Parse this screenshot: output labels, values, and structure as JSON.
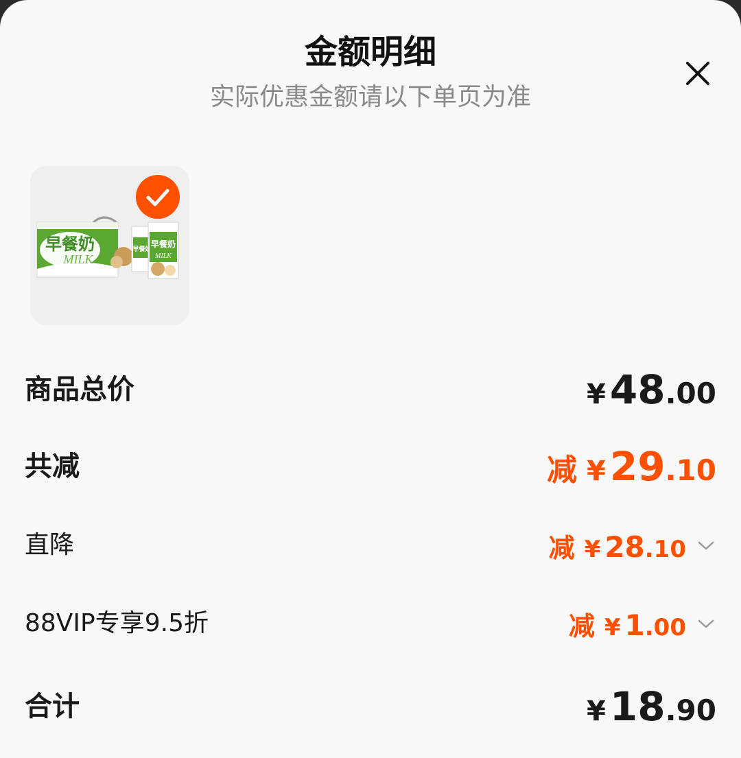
{
  "header": {
    "title": "金额明细",
    "subtitle": "实际优惠金额请以下单页为准"
  },
  "close_icon": "close-icon",
  "product": {
    "image": "早餐奶 MILK product box",
    "image_text": "早餐奶",
    "image_text_en": "MILK",
    "selected": true
  },
  "rows": {
    "total_price": {
      "label": "商品总价",
      "currency": "¥",
      "integer": "48",
      "decimal": ".00"
    },
    "discount_total": {
      "label": "共减",
      "prefix": "减",
      "currency": "¥",
      "integer": "29",
      "decimal": ".10"
    },
    "direct_discount": {
      "label": "直降",
      "prefix": "减",
      "currency": "¥",
      "integer": "28",
      "decimal": ".10"
    },
    "vip_discount": {
      "label": "88VIP专享9.5折",
      "prefix": "减",
      "currency": "¥",
      "integer": "1",
      "decimal": ".00"
    },
    "sum": {
      "label": "合计",
      "currency": "¥",
      "integer": "18",
      "decimal": ".90"
    }
  },
  "colors": {
    "accent": "#ff5000",
    "text": "#1a1a1a",
    "subtext": "#8a8a8a",
    "background": "#f8f8f8",
    "card": "#efefef"
  }
}
